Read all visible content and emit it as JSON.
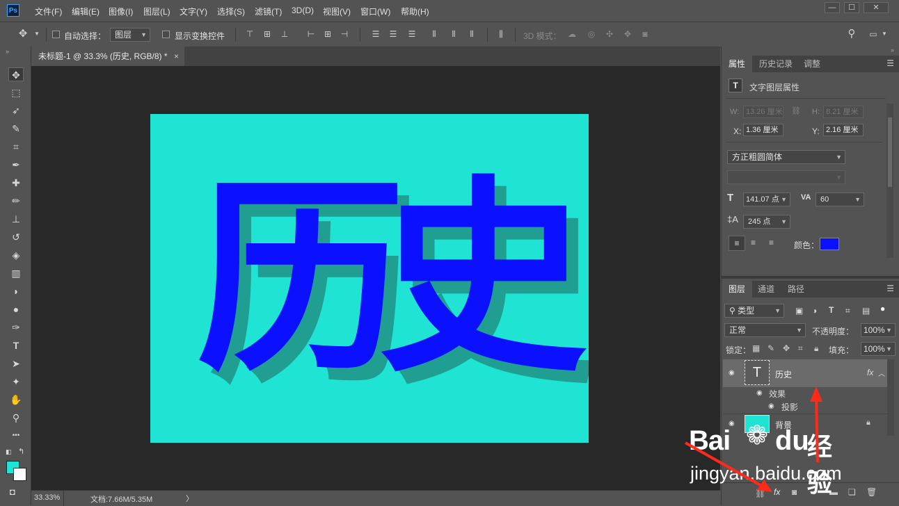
{
  "app": {
    "logo": "Ps"
  },
  "menu": [
    "文件(F)",
    "编辑(E)",
    "图像(I)",
    "图层(L)",
    "文字(Y)",
    "选择(S)",
    "滤镜(T)",
    "3D(D)",
    "视图(V)",
    "窗口(W)",
    "帮助(H)"
  ],
  "window_buttons": [
    "—",
    "☐",
    "✕"
  ],
  "options": {
    "auto_select_label": "自动选择：",
    "auto_select_value": "图层",
    "show_transform_label": "显示变换控件",
    "mode3d_label": "3D 模式："
  },
  "document": {
    "tab_title": "未标题-1 @ 33.3% (历史, RGB/8) *",
    "tab_close": "×",
    "canvas_text_char1": "历",
    "canvas_text_char2": "史",
    "canvas_bg_color": "#1fe3d3",
    "text_color": "#0b10ff",
    "shadow_color": "#1f9e91"
  },
  "status": {
    "zoom": "33.33%",
    "doc_info": "文档:7.66M/5.35M",
    "more": "〉"
  },
  "properties_panel": {
    "tabs": [
      "属性",
      "历史记录",
      "调整"
    ],
    "header": "文字图层属性",
    "w_label": "W:",
    "w_value": "13.26 厘米",
    "h_label": "H:",
    "h_value": "8.21 厘米",
    "x_label": "X:",
    "x_value": "1.36 厘米",
    "y_label": "Y:",
    "y_value": "2.16 厘米",
    "font_family": "方正粗圆简体",
    "font_size": "141.07 点",
    "tracking": "60",
    "leading": "245 点",
    "color_label": "颜色：",
    "color_value": "#0b10ff"
  },
  "layers_panel": {
    "tabs": [
      "图层",
      "通道",
      "路径"
    ],
    "filter_kind": "类型",
    "blend_mode": "正常",
    "opacity_label": "不透明度：",
    "opacity_value": "100%",
    "lock_label": "锁定：",
    "fill_label": "填充：",
    "fill_value": "100%",
    "layers": [
      {
        "name": "历史",
        "type": "text",
        "thumb": "T",
        "fx": "fx",
        "effects_label": "效果",
        "effect": "投影"
      },
      {
        "name": "背景",
        "type": "image"
      }
    ]
  },
  "watermark": {
    "brand_cn": "经验",
    "brand_latin": "Bai",
    "brand_latin2": "du",
    "url": "jingyan.baidu.com"
  },
  "tools": [
    "move-tool",
    "marquee-tool",
    "lasso-tool",
    "quick-select-tool",
    "crop-tool",
    "eyedropper-tool",
    "healing-tool",
    "brush-tool",
    "stamp-tool",
    "history-brush-tool",
    "eraser-tool",
    "gradient-tool",
    "blur-tool",
    "dodge-tool",
    "pen-tool",
    "type-tool",
    "path-select-tool",
    "shape-tool",
    "hand-tool",
    "zoom-tool",
    "more-tool"
  ],
  "tool_glyphs": [
    "✥",
    "⬚",
    "➶",
    "✎",
    "⌗",
    "✒",
    "✚",
    "✏",
    "⊥",
    "↺",
    "◈",
    "▥",
    "◗",
    "●",
    "✑",
    "T",
    "➤",
    "✦",
    "✋",
    "⚲",
    "•••"
  ],
  "swatches": {
    "foreground": "#1fe3d3",
    "background": "#ffffff"
  }
}
